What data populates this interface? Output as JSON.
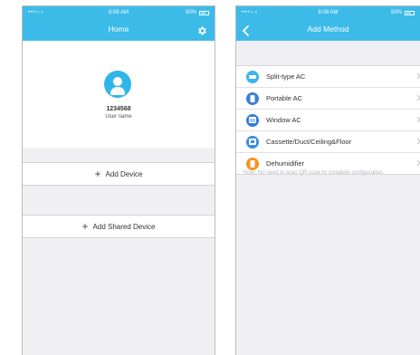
{
  "status_bar": {
    "signal": "•••○○",
    "time": "8:08 AM",
    "battery": "50%"
  },
  "home": {
    "title": "Home",
    "user": {
      "id": "1234568",
      "name": "User name"
    },
    "buttons": {
      "add_device": "Add Device",
      "add_shared_device": "Add Shared Device"
    },
    "icons": {
      "settings": "gear-icon",
      "avatar": "user-avatar-icon",
      "add": "plus-icon"
    }
  },
  "add_method": {
    "title": "Add Method",
    "items": [
      {
        "label": "Split-type AC",
        "icon": "split-ac-icon",
        "color": "#3cb5ea"
      },
      {
        "label": "Portable AC",
        "icon": "portable-ac-icon",
        "color": "#3a7fd5"
      },
      {
        "label": "Window AC",
        "icon": "window-ac-icon",
        "color": "#2f7fd0"
      },
      {
        "label": "Cassette/Duct/Ceiling&Floor",
        "icon": "cassette-ac-icon",
        "color": "#3a8fe0"
      },
      {
        "label": "Dehumidifier",
        "icon": "dehumidifier-icon",
        "color": "#f7941d"
      }
    ],
    "note": "Note: No need to scan QR code to complete configuration."
  },
  "colors": {
    "header": "#3cbbe8",
    "background": "#f0f0f2"
  }
}
